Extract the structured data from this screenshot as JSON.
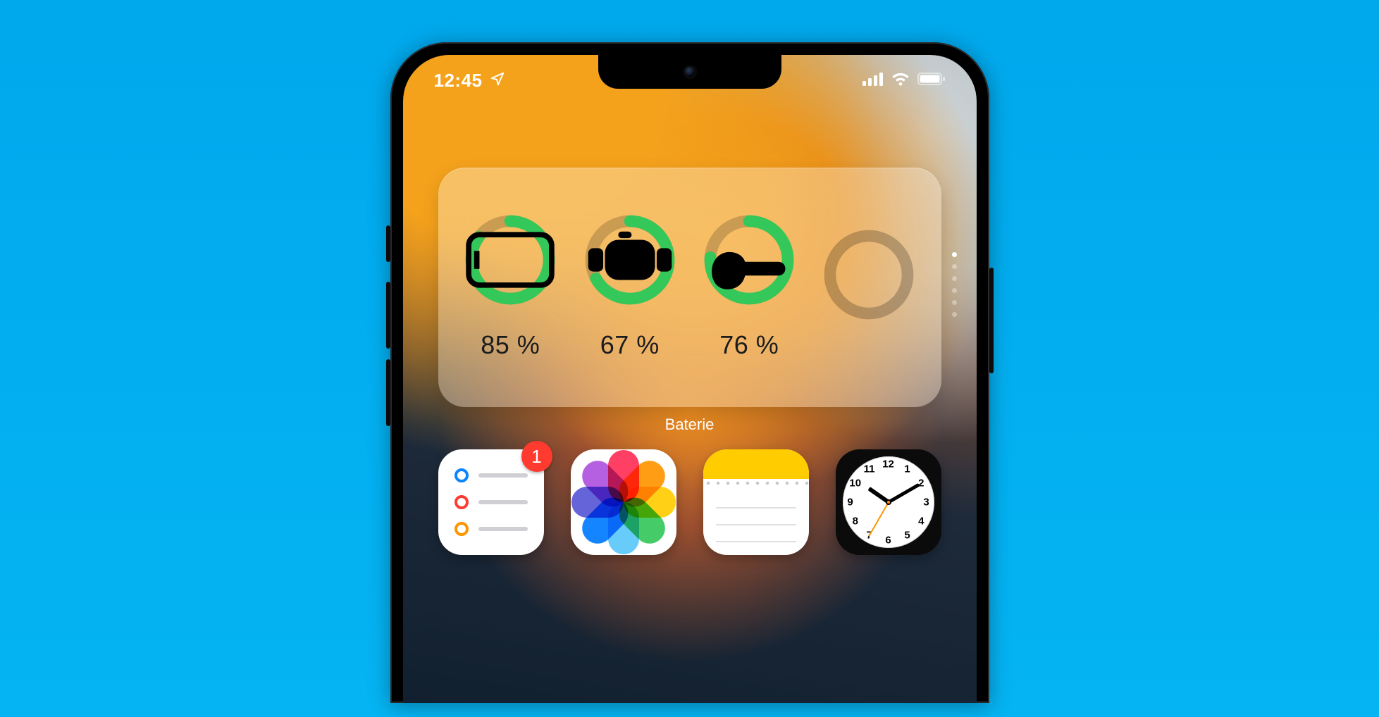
{
  "status": {
    "time": "12:45",
    "location_icon": "location-arrow",
    "signal_bars": 4,
    "wifi_bars": 3,
    "battery_level": 100
  },
  "widget": {
    "label": "Baterie",
    "ring_color": "#34c759",
    "devices": [
      {
        "name": "iphone",
        "percent": 85,
        "percent_label": "85 %",
        "icon": "iphone-icon"
      },
      {
        "name": "apple-watch",
        "percent": 67,
        "percent_label": "67 %",
        "icon": "watch-icon"
      },
      {
        "name": "airpods",
        "percent": 76,
        "percent_label": "76 %",
        "icon": "airpods-icon"
      },
      {
        "name": "empty",
        "percent": 0,
        "percent_label": "",
        "icon": ""
      }
    ],
    "stack_pages": 6,
    "stack_active_index": 0
  },
  "apps": {
    "reminders": {
      "name": "Reminders",
      "badge": "1"
    },
    "photos": {
      "name": "Photos"
    },
    "notes": {
      "name": "Notes"
    },
    "clock": {
      "name": "Clock",
      "numerals": [
        "12",
        "1",
        "2",
        "3",
        "4",
        "5",
        "6",
        "7",
        "8",
        "9",
        "10",
        "11"
      ],
      "hour": 10,
      "minute": 10,
      "second": 35
    }
  },
  "colors": {
    "green": "#34c759",
    "red": "#ff3b30",
    "yellow": "#ffcc00",
    "orange": "#ff9500",
    "background": "#05b4f3"
  }
}
